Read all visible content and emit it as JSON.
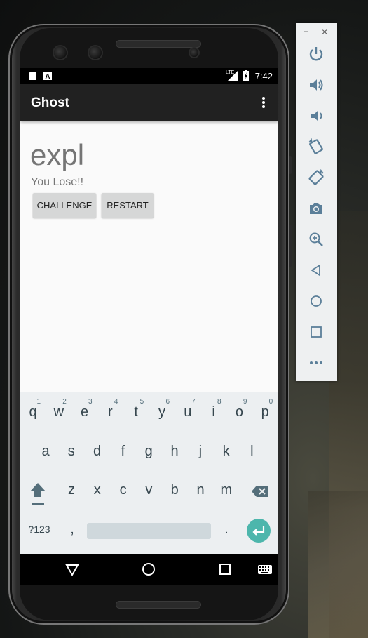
{
  "statusbar": {
    "time": "7:42",
    "network": "LTE"
  },
  "app": {
    "title": "Ghost"
  },
  "game": {
    "word": "expl",
    "status": "You Lose!!",
    "challenge_label": "CHALLENGE",
    "restart_label": "RESTART"
  },
  "keyboard": {
    "row1": [
      "q",
      "w",
      "e",
      "r",
      "t",
      "y",
      "u",
      "i",
      "o",
      "p"
    ],
    "row1_hints": [
      "1",
      "2",
      "3",
      "4",
      "5",
      "6",
      "7",
      "8",
      "9",
      "0"
    ],
    "row2": [
      "a",
      "s",
      "d",
      "f",
      "g",
      "h",
      "j",
      "k",
      "l"
    ],
    "row3": [
      "z",
      "x",
      "c",
      "v",
      "b",
      "n",
      "m"
    ],
    "symbols_label": "?123",
    "comma": ",",
    "period": "."
  },
  "emulator_panel": {
    "buttons": [
      "power-icon",
      "volume-up-icon",
      "volume-down-icon",
      "rotate-left-icon",
      "rotate-right-icon",
      "camera-icon",
      "zoom-icon",
      "back-icon",
      "home-icon",
      "overview-icon",
      "more-icon"
    ],
    "minimize": "−",
    "close": "×"
  },
  "colors": {
    "appbar": "#212121",
    "accent_enter": "#4db6ac",
    "text_gray": "#757575"
  }
}
